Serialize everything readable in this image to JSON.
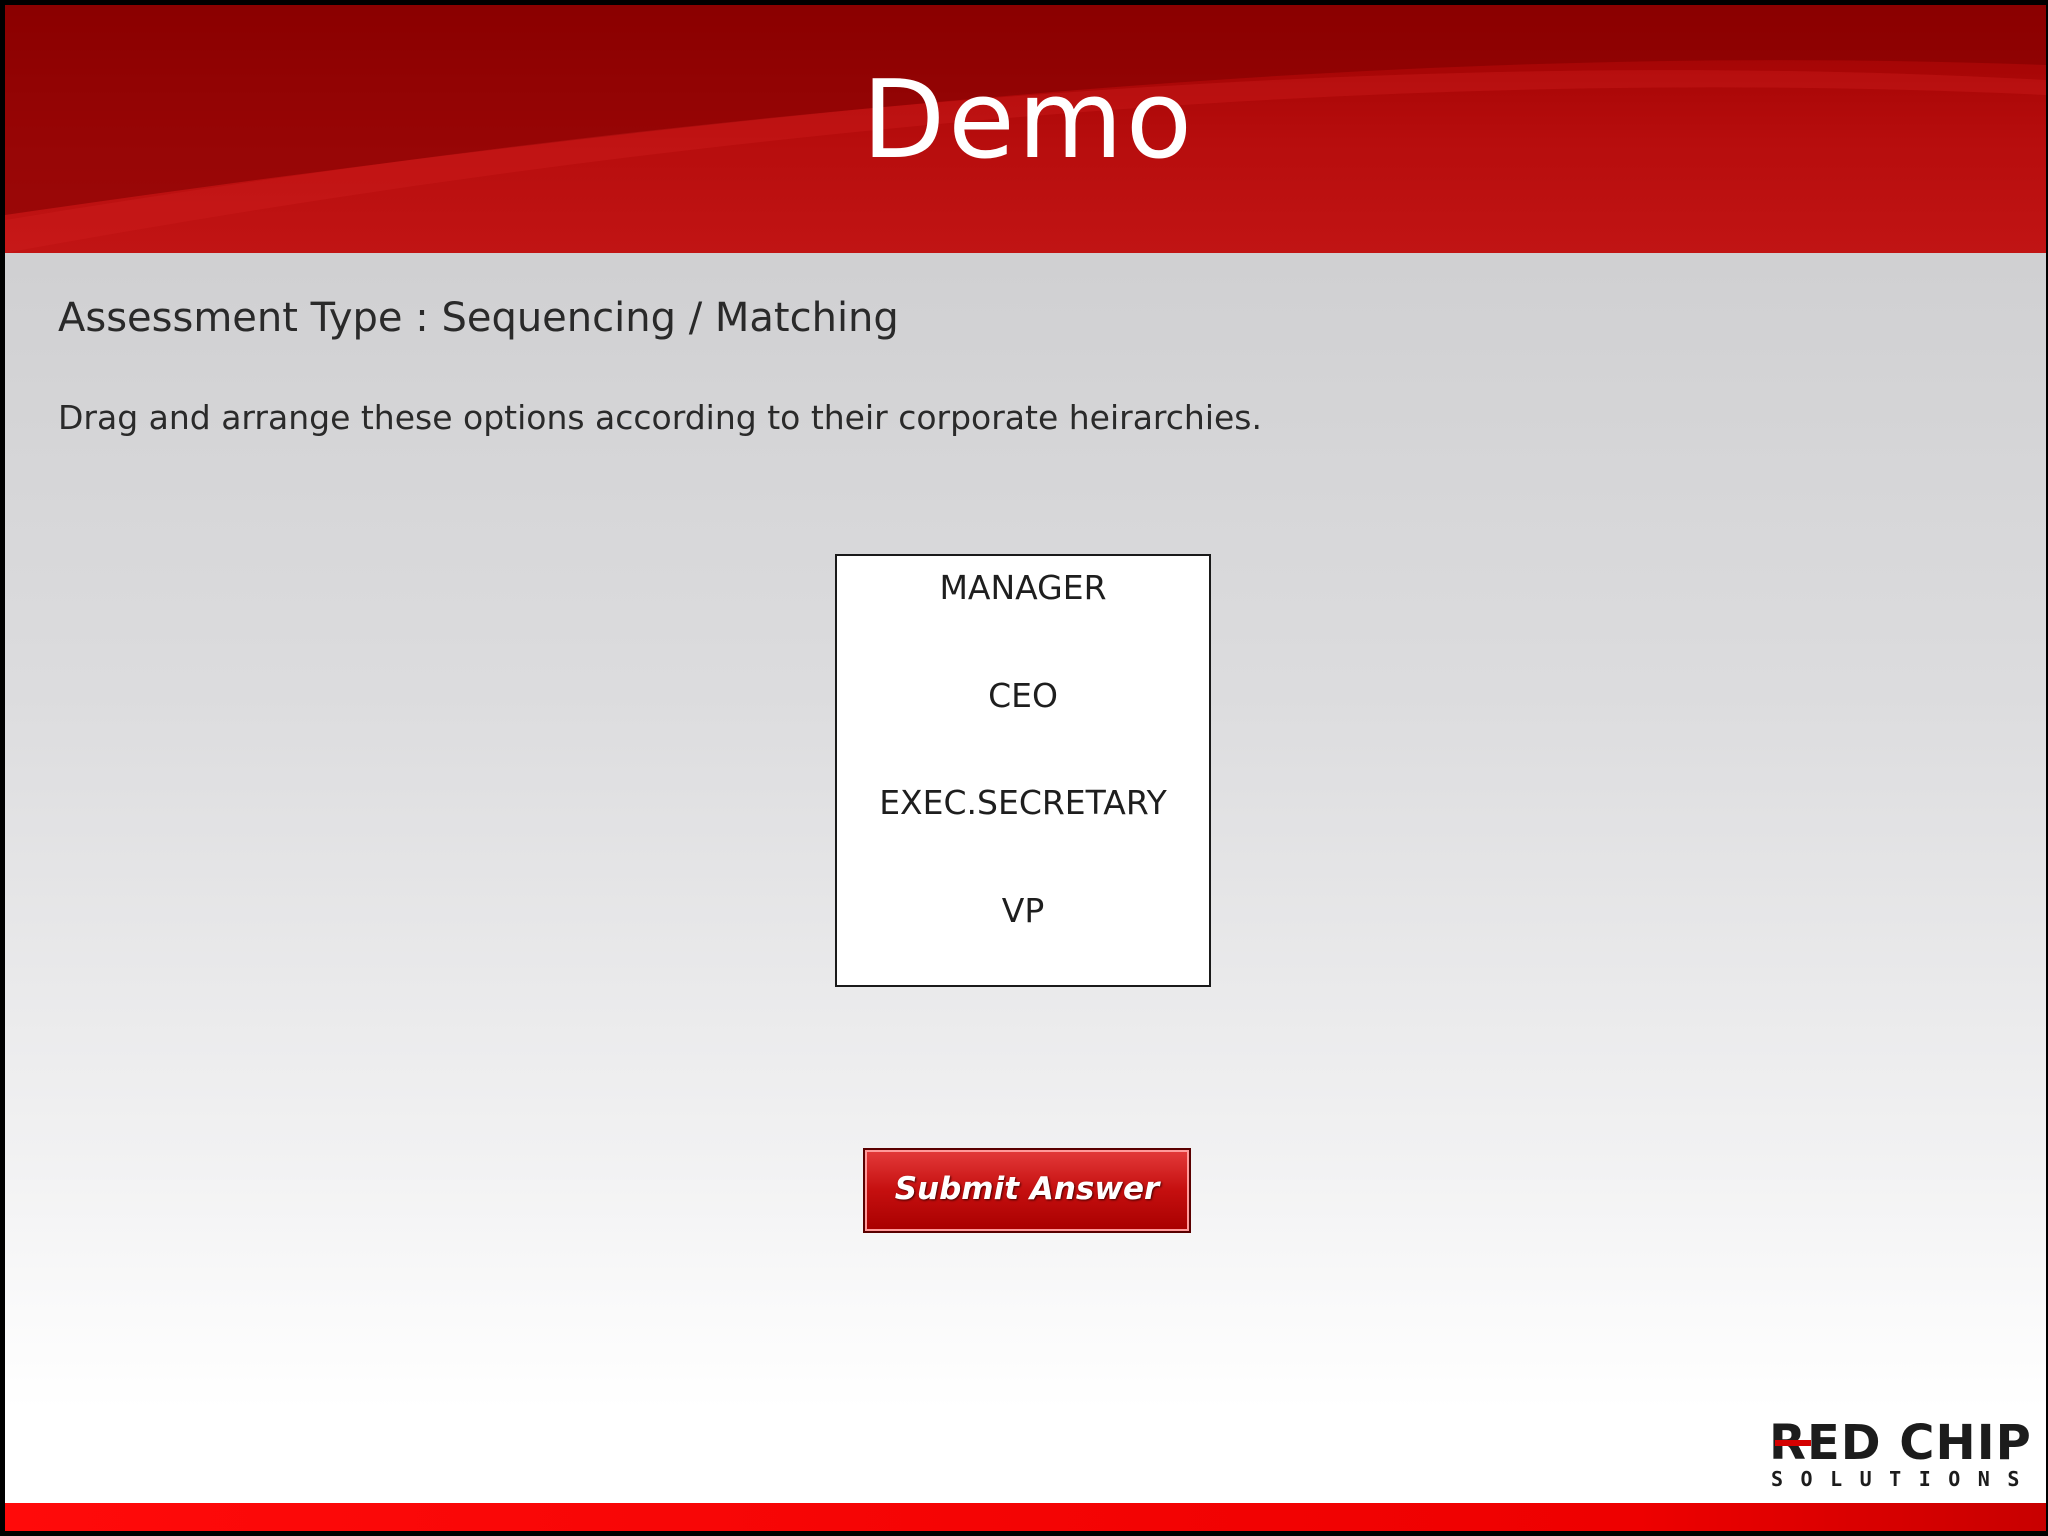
{
  "header": {
    "title": "Demo"
  },
  "assessment": {
    "type_label": "Assessment Type : Sequencing / Matching",
    "instruction": "Drag and arrange these options according to their corporate heirarchies."
  },
  "options": [
    {
      "label": "MANAGER"
    },
    {
      "label": "CEO"
    },
    {
      "label": "EXEC.SECRETARY"
    },
    {
      "label": "VP"
    }
  ],
  "submit": {
    "label": "Submit Answer"
  },
  "logo": {
    "main": "RED CHIP",
    "sub": "SOLUTIONS"
  },
  "colors": {
    "header_red": "#b70d0d",
    "accent_red": "#d40000",
    "text": "#2a2a2a"
  }
}
